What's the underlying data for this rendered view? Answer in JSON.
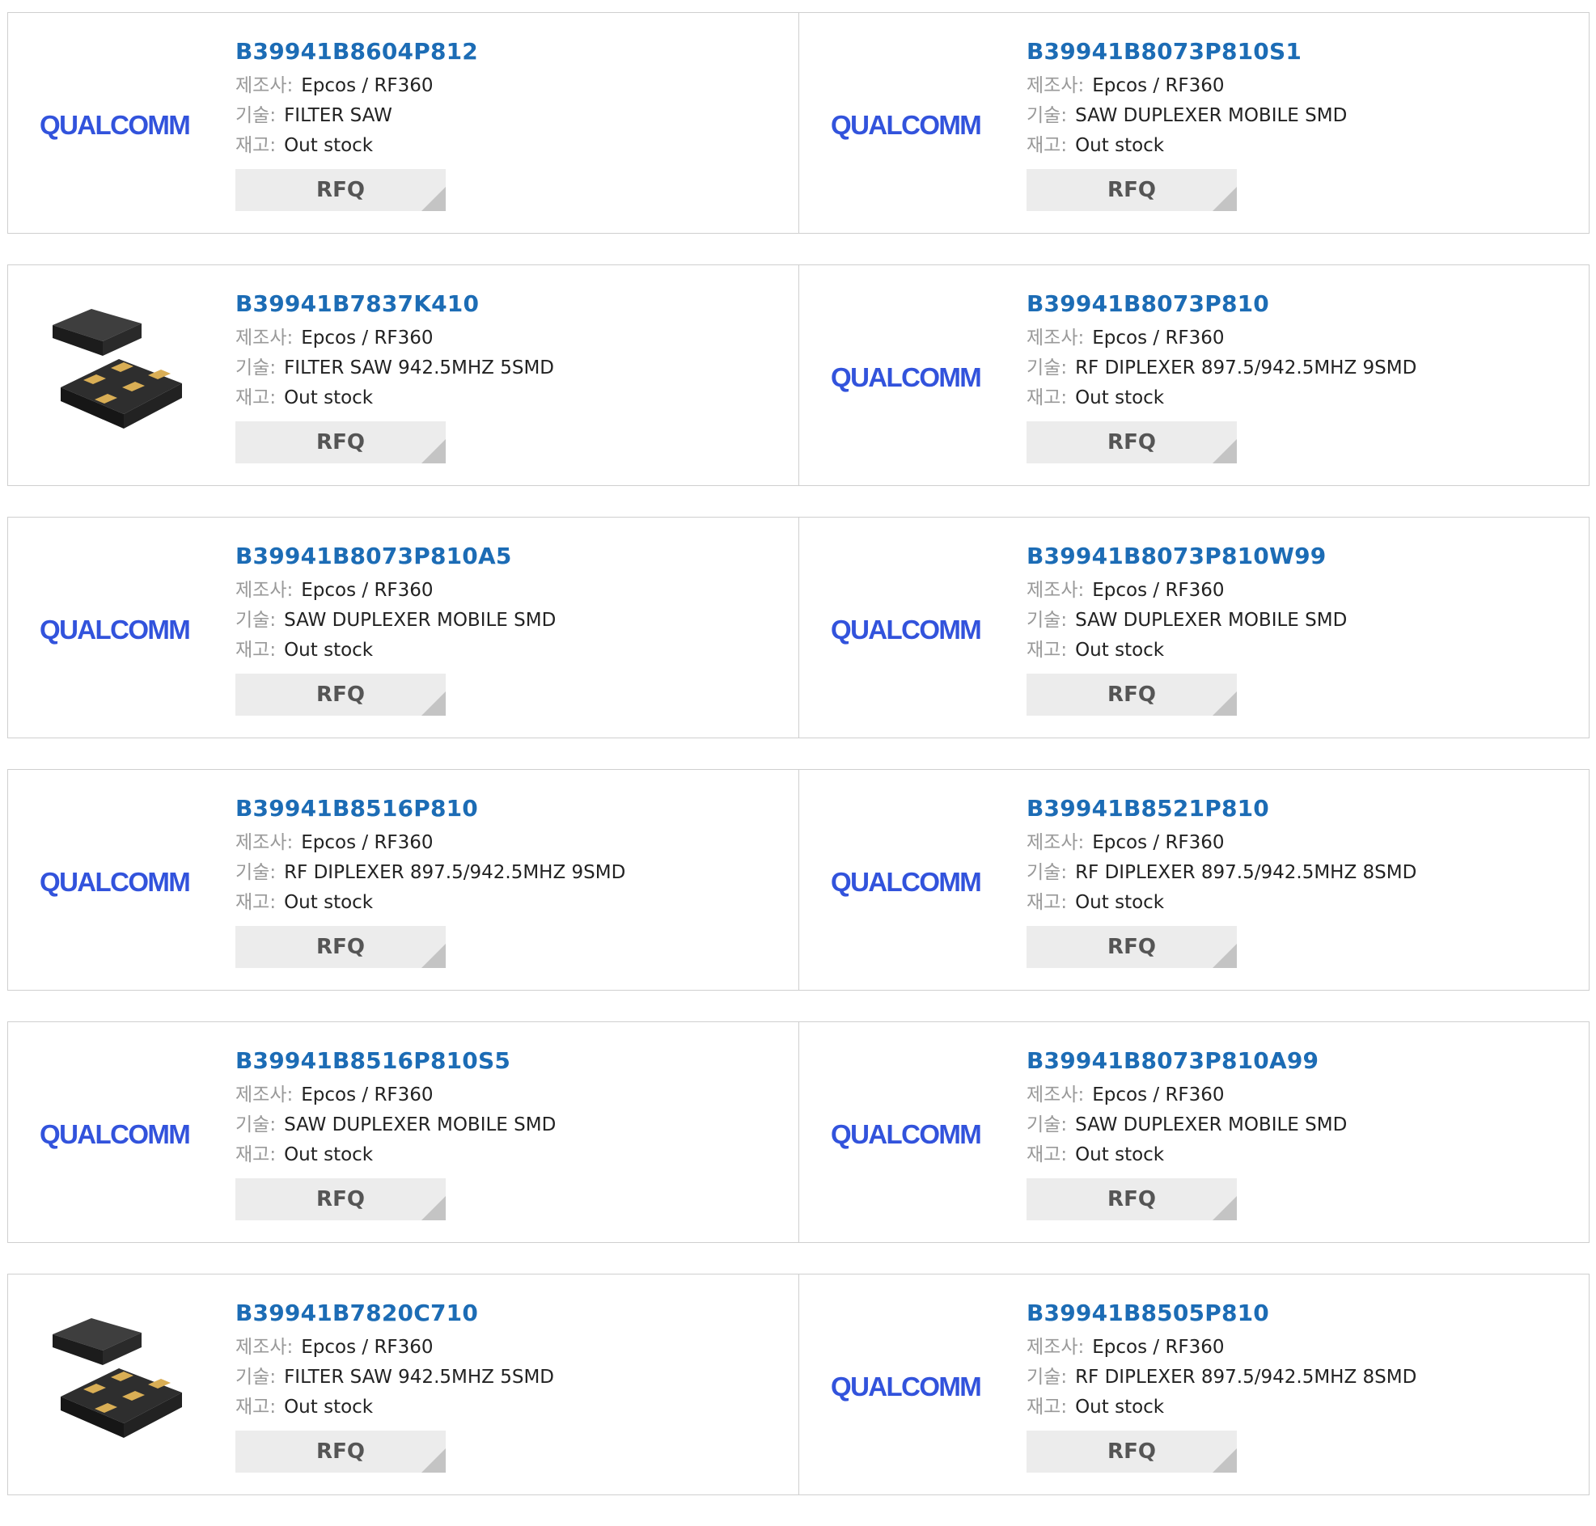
{
  "labels": {
    "manufacturer": "제조사:",
    "technology": "기술:",
    "stock": "재고:"
  },
  "colors": {
    "part_link": "#1c6cb5",
    "label": "#999999",
    "button_bg": "#ececec",
    "border": "#cfcfcf",
    "qualcomm_brand": "#3253dc"
  },
  "brand_logo_text": "QUALCOMM",
  "rfq_label": "RFQ",
  "products": [
    {
      "part": "B39941B8604P812",
      "manufacturer": "Epcos / RF360",
      "technology": "FILTER SAW",
      "stock": "Out stock",
      "image": "qualcomm-logo"
    },
    {
      "part": "B39941B8073P810S1",
      "manufacturer": "Epcos / RF360",
      "technology": "SAW DUPLEXER MOBILE SMD",
      "stock": "Out stock",
      "image": "qualcomm-logo"
    },
    {
      "part": "B39941B7837K410",
      "manufacturer": "Epcos / RF360",
      "technology": "FILTER SAW 942.5MHZ 5SMD",
      "stock": "Out stock",
      "image": "smd-package-photo"
    },
    {
      "part": "B39941B8073P810",
      "manufacturer": "Epcos / RF360",
      "technology": "RF DIPLEXER 897.5/942.5MHZ 9SMD",
      "stock": "Out stock",
      "image": "qualcomm-logo"
    },
    {
      "part": "B39941B8073P810A5",
      "manufacturer": "Epcos / RF360",
      "technology": "SAW DUPLEXER MOBILE SMD",
      "stock": "Out stock",
      "image": "qualcomm-logo"
    },
    {
      "part": "B39941B8073P810W99",
      "manufacturer": "Epcos / RF360",
      "technology": "SAW DUPLEXER MOBILE SMD",
      "stock": "Out stock",
      "image": "qualcomm-logo"
    },
    {
      "part": "B39941B8516P810",
      "manufacturer": "Epcos / RF360",
      "technology": "RF DIPLEXER 897.5/942.5MHZ 9SMD",
      "stock": "Out stock",
      "image": "qualcomm-logo"
    },
    {
      "part": "B39941B8521P810",
      "manufacturer": "Epcos / RF360",
      "technology": "RF DIPLEXER 897.5/942.5MHZ 8SMD",
      "stock": "Out stock",
      "image": "qualcomm-logo"
    },
    {
      "part": "B39941B8516P810S5",
      "manufacturer": "Epcos / RF360",
      "technology": "SAW DUPLEXER MOBILE SMD",
      "stock": "Out stock",
      "image": "qualcomm-logo"
    },
    {
      "part": "B39941B8073P810A99",
      "manufacturer": "Epcos / RF360",
      "technology": "SAW DUPLEXER MOBILE SMD",
      "stock": "Out stock",
      "image": "qualcomm-logo"
    },
    {
      "part": "B39941B7820C710",
      "manufacturer": "Epcos / RF360",
      "technology": "FILTER SAW 942.5MHZ 5SMD",
      "stock": "Out stock",
      "image": "smd-package-photo"
    },
    {
      "part": "B39941B8505P810",
      "manufacturer": "Epcos / RF360",
      "technology": "RF DIPLEXER 897.5/942.5MHZ 8SMD",
      "stock": "Out stock",
      "image": "qualcomm-logo"
    }
  ]
}
